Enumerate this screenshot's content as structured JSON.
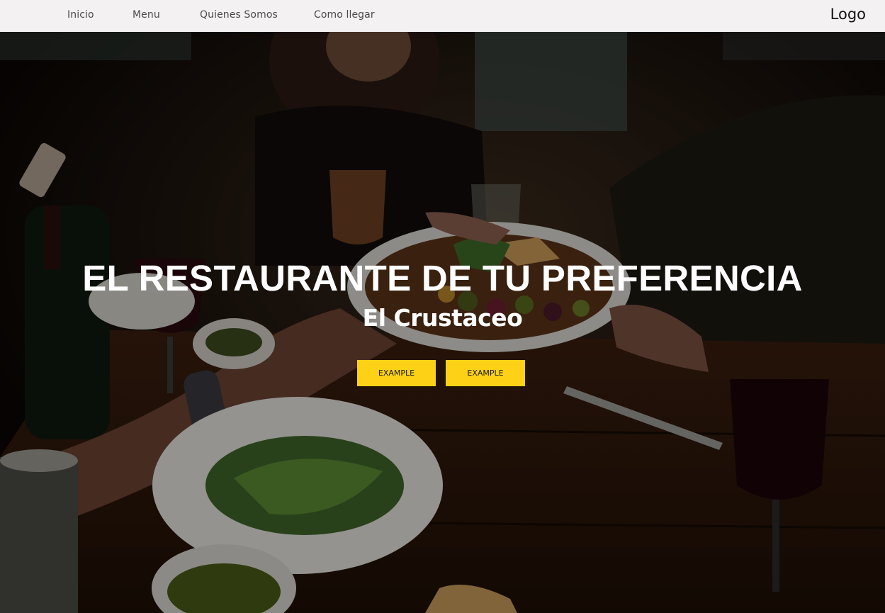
{
  "nav": {
    "links": [
      "Inicio",
      "Menu",
      "Quienes Somos",
      "Como llegar"
    ],
    "logo": "Logo"
  },
  "hero": {
    "title": "EL RESTAURANTE DE TU PREFERENCIA",
    "subtitle": "El Crustaceo",
    "buttons": [
      "EXAMPLE",
      "EXAMPLE"
    ],
    "background_image": "restaurant-dinner-table-photo"
  },
  "colors": {
    "nav_bg": "#f4f1f2",
    "button_bg": "#fcd116",
    "hero_text": "#ffffff"
  }
}
